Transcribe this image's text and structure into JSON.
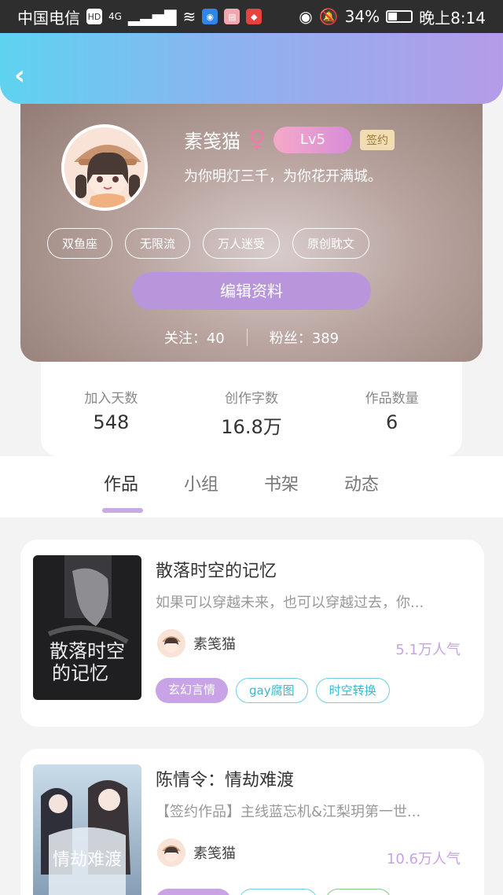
{
  "status_bar": {
    "carrier": "中国电信",
    "network_badges": [
      "HD",
      "4G"
    ],
    "battery": "34%",
    "time": "晚上8:14"
  },
  "header": {
    "back_icon": "chevron-left-icon"
  },
  "profile": {
    "name": "素笺猫",
    "gender_symbol": "♀",
    "level": "Lv5",
    "signed_badge": "签约",
    "motto": "为你明灯三千，为你花开满城。",
    "tags": [
      "双鱼座",
      "无限流",
      "万人迷受",
      "原创耽文"
    ],
    "edit_label": "编辑资料",
    "following": "关注：40",
    "followers": "粉丝：389"
  },
  "stats": [
    {
      "label": "加入天数",
      "value": "548"
    },
    {
      "label": "创作字数",
      "value": "16.8万"
    },
    {
      "label": "作品数量",
      "value": "6"
    }
  ],
  "tabs": [
    "作品",
    "小组",
    "书架",
    "动态"
  ],
  "active_tab": 0,
  "books": [
    {
      "title": "散落时空的记忆",
      "description": "如果可以穿越未来，也可以穿越过去，你...",
      "cover_title": "散落时空的记忆",
      "author": "素笺猫",
      "popularity": "5.1万人气",
      "tags": [
        "玄幻言情",
        "gay腐图",
        "时空转换"
      ]
    },
    {
      "title": "陈情令：情劫难渡",
      "description": "【签约作品】主线蓝忘机&江梨玥第一世...",
      "cover_title": "情劫难渡",
      "author": "素笺猫",
      "popularity": "10.6万人气",
      "tags": [
        "",
        "",
        ""
      ]
    }
  ],
  "colors": {
    "header_gradient_start": "#5ed3f0",
    "header_gradient_end": "#b59be8",
    "accent_purple": "#c8a3e6",
    "tag_cyan": "#6fd0e0"
  }
}
